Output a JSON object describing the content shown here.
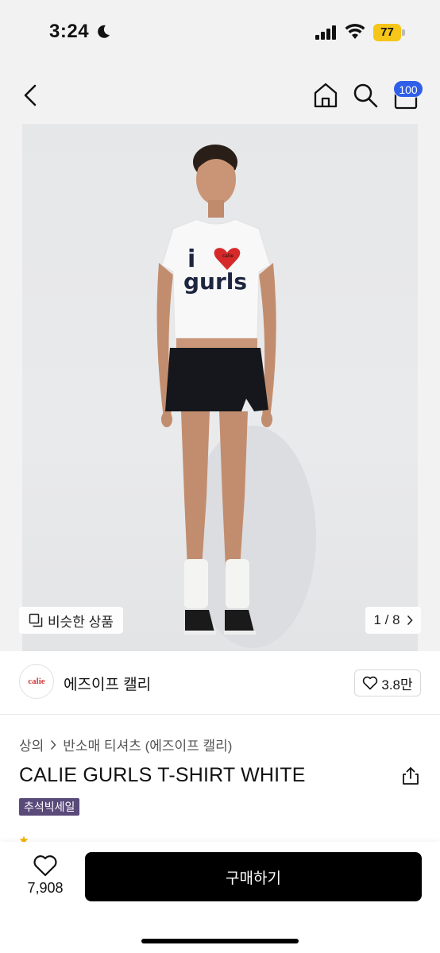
{
  "status_bar": {
    "time": "3:24",
    "battery_level": "77",
    "icons": [
      "moon-icon",
      "signal-icon",
      "wifi-icon",
      "battery-icon"
    ]
  },
  "nav": {
    "icons": [
      "back-arrow-icon",
      "home-icon",
      "search-icon",
      "cart-icon"
    ],
    "cart_badge": "100"
  },
  "product_image": {
    "similar_label": "비슷한 상품",
    "page_indicator": "1 / 8",
    "image_text": "i gurls",
    "heart_text": "calie"
  },
  "shop": {
    "logo_text": "calie",
    "name": "에즈이프 캘리",
    "likes": "3.8만"
  },
  "product": {
    "breadcrumb_1": "상의",
    "breadcrumb_2": "반소매 티셔츠 (에즈이프 캘리)",
    "title": "CALIE GURLS T-SHIRT WHITE",
    "sale_badge": "추석빅세일"
  },
  "bottom_bar": {
    "wish_count": "7,908",
    "buy_label": "구매하기"
  },
  "colors": {
    "cart_badge": "#2f5fe8",
    "battery": "#f5c518",
    "sale_badge": "#5a4a7a",
    "buy_button": "#000000"
  }
}
